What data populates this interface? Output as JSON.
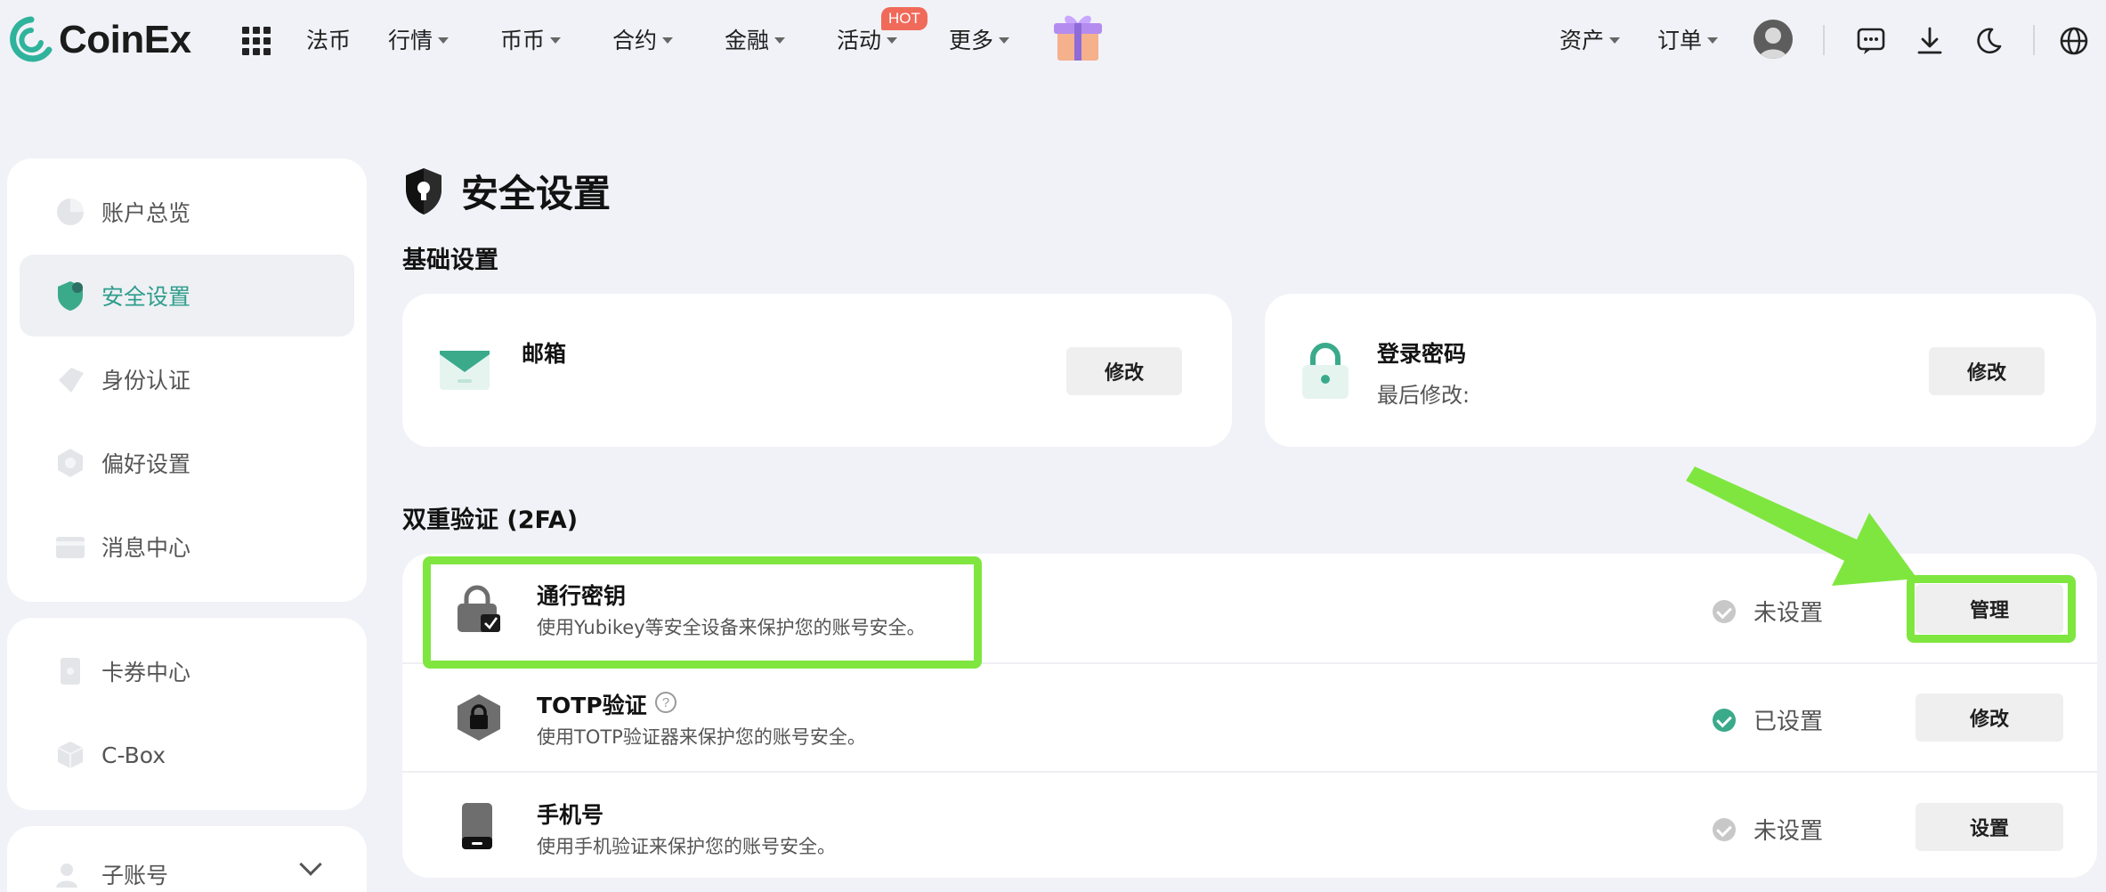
{
  "brand": {
    "name": "CoinEx",
    "accent": "#2e9d8c"
  },
  "nav": {
    "items": [
      {
        "label": "法币",
        "caret": false
      },
      {
        "label": "行情",
        "caret": true
      },
      {
        "label": "币币",
        "caret": true
      },
      {
        "label": "合约",
        "caret": true
      },
      {
        "label": "金融",
        "caret": true
      },
      {
        "label": "活动",
        "caret": true
      },
      {
        "label": "更多",
        "caret": true
      }
    ],
    "hot_badge": "HOT",
    "right": {
      "assets": "资产",
      "orders": "订单"
    },
    "icons": [
      "apps-grid-icon",
      "gift-icon",
      "avatar",
      "chat-icon",
      "download-icon",
      "moon-icon",
      "globe-icon"
    ]
  },
  "sidebar": {
    "group1": [
      {
        "label": "账户总览",
        "icon": "pie-chart-icon"
      },
      {
        "label": "安全设置",
        "icon": "shield-icon",
        "active": true
      },
      {
        "label": "身份认证",
        "icon": "id-tag-icon"
      },
      {
        "label": "偏好设置",
        "icon": "settings-hex-icon"
      },
      {
        "label": "消息中心",
        "icon": "message-card-icon"
      }
    ],
    "group2": [
      {
        "label": "卡券中心",
        "icon": "coupon-icon"
      },
      {
        "label": "C-Box",
        "icon": "box-icon"
      }
    ],
    "group3": [
      {
        "label": "子账号",
        "icon": "sub-account-icon"
      }
    ]
  },
  "main": {
    "title": "安全设置",
    "basic_section": {
      "title": "基础设置",
      "email": {
        "label": "邮箱",
        "button": "修改"
      },
      "password": {
        "label": "登录密码",
        "sub": "最后修改:",
        "button": "修改"
      }
    },
    "tfa_section": {
      "title": "双重验证 (2FA)",
      "rows": [
        {
          "title": "通行密钥",
          "desc": "使用Yubikey等安全设备来保护您的账号安全。",
          "status": "未设置",
          "status_color": "grey",
          "button": "管理"
        },
        {
          "title": "TOTP验证",
          "desc": "使用TOTP验证器来保护您的账号安全。",
          "status": "已设置",
          "status_color": "green",
          "button": "修改",
          "help": "?"
        },
        {
          "title": "手机号",
          "desc": "使用手机验证来保护您的账号安全。",
          "status": "未设置",
          "status_color": "grey",
          "button": "设置"
        }
      ]
    }
  },
  "annotation_color": "#7fe640"
}
